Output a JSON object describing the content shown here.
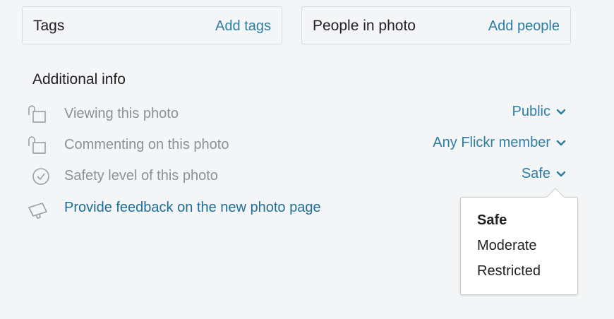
{
  "tags": {
    "title": "Tags",
    "action": "Add tags"
  },
  "people": {
    "title": "People in photo",
    "action": "Add people"
  },
  "additional_info": {
    "title": "Additional info",
    "rows": [
      {
        "label": "Viewing this photo",
        "value": "Public",
        "icon": "unlock-icon"
      },
      {
        "label": "Commenting on this photo",
        "value": "Any Flickr member",
        "icon": "unlock-icon"
      },
      {
        "label": "Safety level of this photo",
        "value": "Safe",
        "icon": "check-circle-icon"
      }
    ],
    "feedback": {
      "label": "Provide feedback on the new photo page",
      "icon": "megaphone-icon"
    }
  },
  "safety_dropdown": {
    "selected": "Safe",
    "options": [
      "Safe",
      "Moderate",
      "Restricted"
    ]
  },
  "colors": {
    "link": "#2e7ea6",
    "muted_text": "#8d9196",
    "text": "#212124",
    "background": "#f3f5f6"
  }
}
